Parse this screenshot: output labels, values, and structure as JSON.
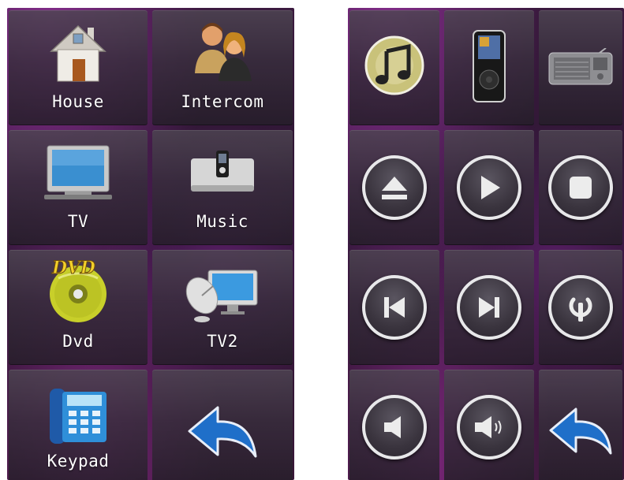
{
  "left_panel": {
    "tiles": [
      {
        "label": "House",
        "icon": "house-icon"
      },
      {
        "label": "Intercom",
        "icon": "intercom-people-icon"
      },
      {
        "label": "TV",
        "icon": "tv-icon"
      },
      {
        "label": "Music",
        "icon": "music-dock-icon"
      },
      {
        "label": "Dvd",
        "icon": "dvd-disc-icon"
      },
      {
        "label": "TV2",
        "icon": "satellite-tv-icon"
      },
      {
        "label": "Keypad",
        "icon": "keypad-phone-icon"
      },
      {
        "label": "",
        "icon": "back-arrow-icon"
      }
    ]
  },
  "right_panel": {
    "sources": [
      "itunes-icon",
      "ipod-icon",
      "radio-icon"
    ],
    "controls": [
      "eject-icon",
      "play-icon",
      "stop-icon",
      "previous-icon",
      "next-icon",
      "power-icon",
      "mute-icon",
      "volume-up-icon",
      "back-arrow-icon"
    ]
  },
  "colors": {
    "panel_background": "#2f1833",
    "accent_purple": "#a03cb4",
    "button_ring": "#e8e8ea",
    "arrow_blue": "#1f6fc9"
  }
}
